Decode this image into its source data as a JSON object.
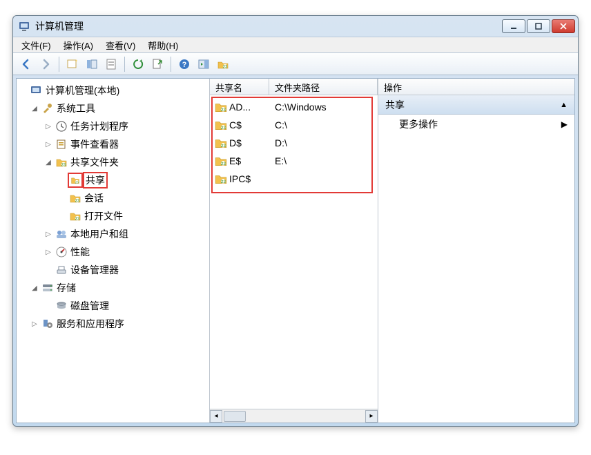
{
  "window": {
    "title": "计算机管理"
  },
  "menu": {
    "file": "文件(F)",
    "action": "操作(A)",
    "view": "查看(V)",
    "help": "帮助(H)"
  },
  "tree": {
    "root": "计算机管理(本地)",
    "system_tools": "系统工具",
    "task_scheduler": "任务计划程序",
    "event_viewer": "事件查看器",
    "shared_folders": "共享文件夹",
    "shares": "共享",
    "sessions": "会话",
    "open_files": "打开文件",
    "local_users": "本地用户和组",
    "performance": "性能",
    "device_manager": "设备管理器",
    "storage": "存储",
    "disk_mgmt": "磁盘管理",
    "services_apps": "服务和应用程序"
  },
  "list": {
    "columns": {
      "name": "共享名",
      "path": "文件夹路径"
    },
    "rows": [
      {
        "name": "AD...",
        "path": "C:\\Windows"
      },
      {
        "name": "C$",
        "path": "C:\\"
      },
      {
        "name": "D$",
        "path": "D:\\"
      },
      {
        "name": "E$",
        "path": "E:\\"
      },
      {
        "name": "IPC$",
        "path": ""
      }
    ]
  },
  "actions": {
    "header": "操作",
    "section": "共享",
    "more": "更多操作"
  }
}
